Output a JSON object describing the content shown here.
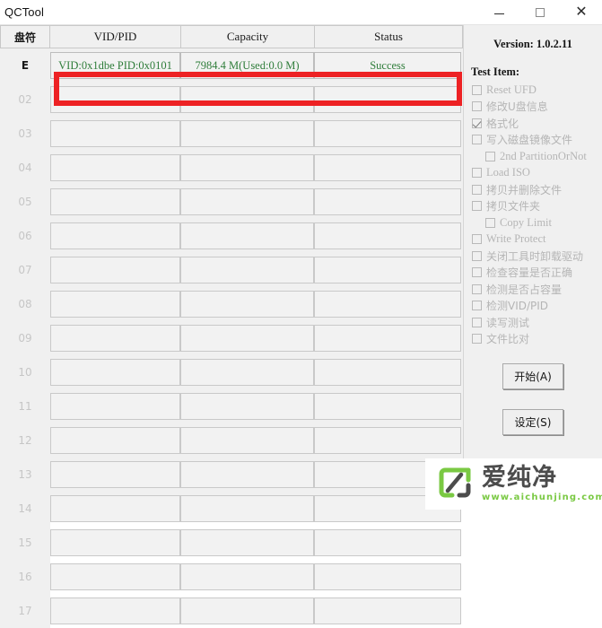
{
  "window": {
    "title": "QCTool",
    "minimize_label": "minimize",
    "maximize_label": "maximize",
    "close_label": "✕"
  },
  "grid": {
    "columns": [
      {
        "key": "drive",
        "label": "盘符"
      },
      {
        "key": "vidpid",
        "label": "VID/PID"
      },
      {
        "key": "capacity",
        "label": "Capacity"
      },
      {
        "key": "status",
        "label": "Status"
      }
    ],
    "rows": [
      {
        "drive": "E",
        "vidpid": "VID:0x1dbe PID:0x0101",
        "capacity": "7984.4 M(Used:0.0 M)",
        "status": "Success",
        "active": true
      },
      {
        "drive": "02",
        "vidpid": "",
        "capacity": "",
        "status": "",
        "active": false
      },
      {
        "drive": "03",
        "vidpid": "",
        "capacity": "",
        "status": "",
        "active": false
      },
      {
        "drive": "04",
        "vidpid": "",
        "capacity": "",
        "status": "",
        "active": false
      },
      {
        "drive": "05",
        "vidpid": "",
        "capacity": "",
        "status": "",
        "active": false
      },
      {
        "drive": "06",
        "vidpid": "",
        "capacity": "",
        "status": "",
        "active": false
      },
      {
        "drive": "07",
        "vidpid": "",
        "capacity": "",
        "status": "",
        "active": false
      },
      {
        "drive": "08",
        "vidpid": "",
        "capacity": "",
        "status": "",
        "active": false
      },
      {
        "drive": "09",
        "vidpid": "",
        "capacity": "",
        "status": "",
        "active": false
      },
      {
        "drive": "10",
        "vidpid": "",
        "capacity": "",
        "status": "",
        "active": false
      },
      {
        "drive": "11",
        "vidpid": "",
        "capacity": "",
        "status": "",
        "active": false
      },
      {
        "drive": "12",
        "vidpid": "",
        "capacity": "",
        "status": "",
        "active": false
      },
      {
        "drive": "13",
        "vidpid": "",
        "capacity": "",
        "status": "",
        "active": false
      },
      {
        "drive": "14",
        "vidpid": "",
        "capacity": "",
        "status": "",
        "active": false
      },
      {
        "drive": "15",
        "vidpid": "",
        "capacity": "",
        "status": "",
        "active": false
      },
      {
        "drive": "16",
        "vidpid": "",
        "capacity": "",
        "status": "",
        "active": false
      },
      {
        "drive": "17",
        "vidpid": "",
        "capacity": "",
        "status": "",
        "active": false
      }
    ],
    "highlight_color": "#ed2224",
    "success_text_color": "#2f7d3a"
  },
  "panel": {
    "version": "Version: 1.0.2.11",
    "test_item_title": "Test Item:",
    "test_items": [
      {
        "label": "Reset UFD",
        "checked": false,
        "indent": false,
        "zh": false
      },
      {
        "label": "修改U盘信息",
        "checked": false,
        "indent": false,
        "zh": true
      },
      {
        "label": "格式化",
        "checked": true,
        "indent": false,
        "zh": true
      },
      {
        "label": "写入磁盘镜像文件",
        "checked": false,
        "indent": false,
        "zh": true
      },
      {
        "label": "2nd PartitionOrNot",
        "checked": false,
        "indent": true,
        "zh": false
      },
      {
        "label": "Load ISO",
        "checked": false,
        "indent": false,
        "zh": false
      },
      {
        "label": "拷贝并删除文件",
        "checked": false,
        "indent": false,
        "zh": true
      },
      {
        "label": "拷贝文件夹",
        "checked": false,
        "indent": false,
        "zh": true
      },
      {
        "label": "Copy Limit",
        "checked": false,
        "indent": true,
        "zh": false
      },
      {
        "label": "Write Protect",
        "checked": false,
        "indent": false,
        "zh": false
      },
      {
        "label": "关闭工具时卸载驱动",
        "checked": false,
        "indent": false,
        "zh": true
      },
      {
        "label": "检查容量是否正确",
        "checked": false,
        "indent": false,
        "zh": true
      },
      {
        "label": "检测是否占容量",
        "checked": false,
        "indent": false,
        "zh": true
      },
      {
        "label": "检测VID/PID",
        "checked": false,
        "indent": false,
        "zh": true
      },
      {
        "label": "读写测试",
        "checked": false,
        "indent": false,
        "zh": true
      },
      {
        "label": "文件比对",
        "checked": false,
        "indent": false,
        "zh": true
      }
    ],
    "start_button": "开始(A)",
    "settings_button": "设定(S)"
  },
  "watermark": {
    "name": "爱纯净",
    "url": "www.aichunjing.com",
    "logo_color": "#7ac943",
    "logo_dark": "#4c4c4c"
  }
}
